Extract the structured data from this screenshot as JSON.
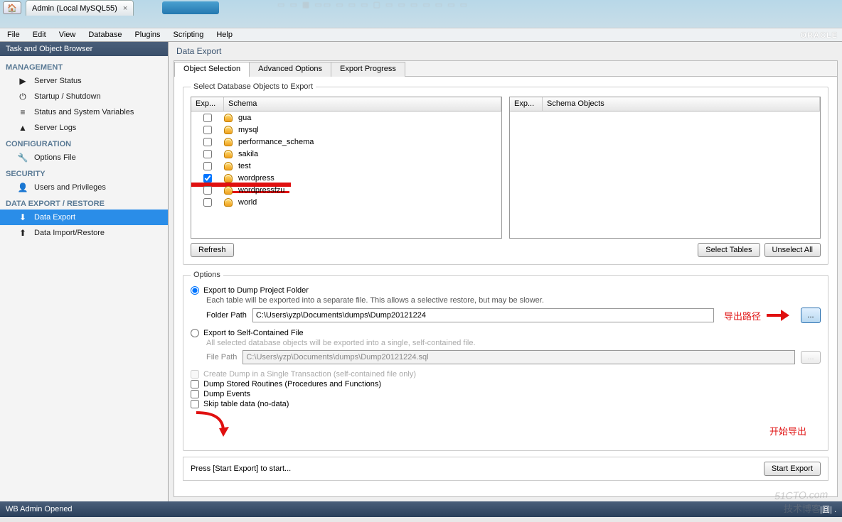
{
  "window": {
    "tab_title": "Admin (Local MySQL55)",
    "brand": "ORACLE"
  },
  "menu": [
    "File",
    "Edit",
    "View",
    "Database",
    "Plugins",
    "Scripting",
    "Help"
  ],
  "sidebar": {
    "title": "Task and Object Browser",
    "groups": [
      {
        "head": "MANAGEMENT",
        "items": [
          {
            "icon": "▶",
            "label": "Server Status"
          },
          {
            "icon": "⏻",
            "label": "Startup / Shutdown"
          },
          {
            "icon": "≡",
            "label": "Status and System Variables"
          },
          {
            "icon": "▲",
            "label": "Server Logs"
          }
        ]
      },
      {
        "head": "CONFIGURATION",
        "items": [
          {
            "icon": "🔧",
            "label": "Options File"
          }
        ]
      },
      {
        "head": "SECURITY",
        "items": [
          {
            "icon": "👤",
            "label": "Users and Privileges"
          }
        ]
      },
      {
        "head": "DATA EXPORT / RESTORE",
        "items": [
          {
            "icon": "⬇",
            "label": "Data Export",
            "active": true
          },
          {
            "icon": "⬆",
            "label": "Data Import/Restore"
          }
        ]
      }
    ]
  },
  "content": {
    "title": "Data Export",
    "tabs": [
      "Object Selection",
      "Advanced Options",
      "Export Progress"
    ],
    "active_tab": 0,
    "select_legend": "Select Database Objects to Export",
    "cols": {
      "exp": "Exp...",
      "schema": "Schema",
      "exp2": "Exp...",
      "obj": "Schema Objects"
    },
    "schemas": [
      "gua",
      "mysql",
      "performance_schema",
      "sakila",
      "test",
      "wordpress",
      "wordpressfzu",
      "world"
    ],
    "buttons": {
      "refresh": "Refresh",
      "sel_tables": "Select Tables",
      "unsel_all": "Unselect All",
      "start": "Start Export"
    },
    "options": {
      "legend": "Options",
      "r1": "Export to Dump Project Folder",
      "r1_note": "Each table will be exported into a separate file. This allows a selective restore, but may be slower.",
      "folder_lbl": "Folder Path",
      "folder_val": "C:\\Users\\yzp\\Documents\\dumps\\Dump20121224",
      "r2": "Export to Self-Contained File",
      "r2_note": "All selected database objects will be exported into a single, self-contained file.",
      "file_lbl": "File Path",
      "file_val": "C:\\Users\\yzp\\Documents\\dumps\\Dump20121224.sql",
      "c1": "Create Dump in a Single Transaction (self-contained file only)",
      "c2": "Dump Stored Routines (Procedures and Functions)",
      "c3": "Dump Events",
      "c4": "Skip table data (no-data)"
    },
    "press_hint": "Press [Start Export] to start..."
  },
  "annotations": {
    "path": "导出路径",
    "start": "开始导出"
  },
  "status": "WB Admin Opened",
  "watermark": {
    "a": "51CTO.com",
    "b": "技术博客"
  }
}
